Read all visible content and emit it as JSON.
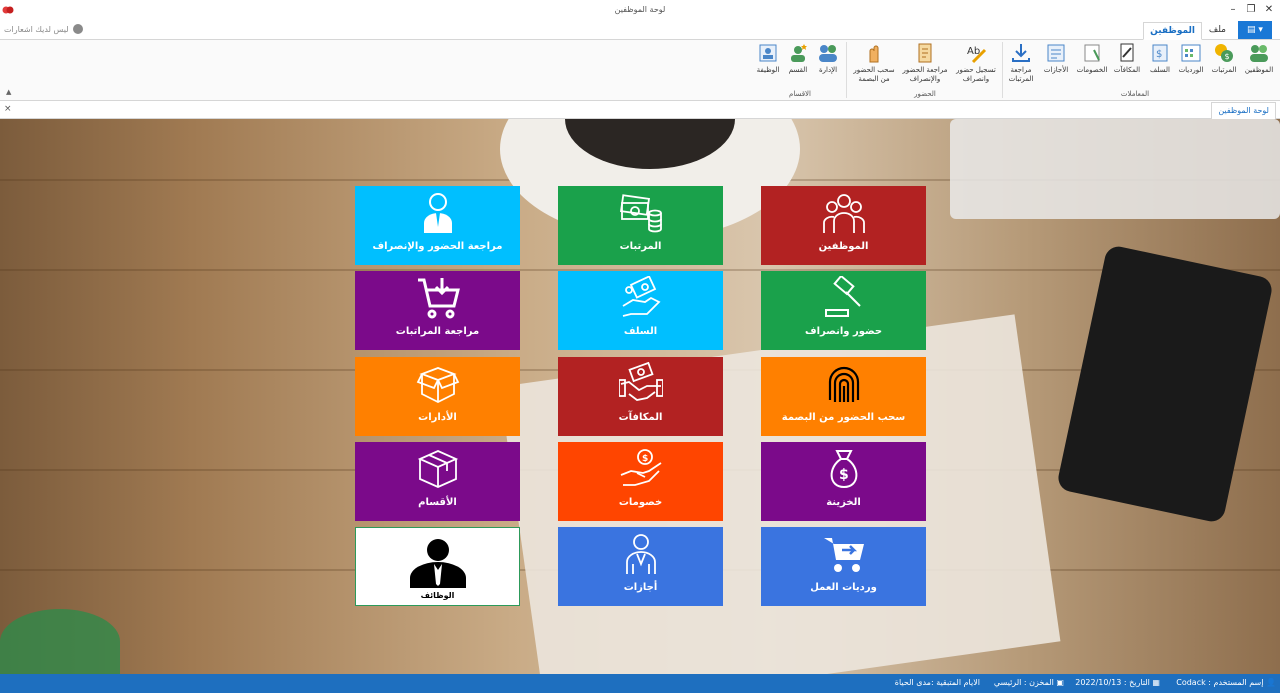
{
  "window": {
    "title": "لوحة الموظفين",
    "controls": {
      "minimize": "–",
      "restore": "❐",
      "close": "✕"
    }
  },
  "tabs": {
    "file_label": "",
    "file_icon": "app-menu-icon",
    "items": [
      {
        "label": "الموظفين",
        "active": true
      },
      {
        "label": "ملف",
        "active": false
      }
    ],
    "notifications_text": "ليس لديك اشعارات"
  },
  "ribbon": {
    "groups": {
      "transactions": "المعاملات",
      "attendance": "الحضور",
      "departments": "الاقسام"
    },
    "buttons": [
      {
        "label": "الموظفين",
        "icon": "employees-icon"
      },
      {
        "label": "المرتبات",
        "icon": "salaries-icon"
      },
      {
        "label": "الورديات",
        "icon": "shifts-icon"
      },
      {
        "label": "السلف",
        "icon": "advances-icon"
      },
      {
        "label": "المكافآت",
        "icon": "bonuses-icon"
      },
      {
        "label": "الخصومات",
        "icon": "deductions-icon"
      },
      {
        "label": "الأجازات",
        "icon": "vacations-icon"
      },
      {
        "label": "مراجعة المرتبات",
        "icon": "review-salaries-icon"
      },
      {
        "label": "تسجيل حضور وانصراف",
        "icon": "register-attendance-icon"
      },
      {
        "label": "مراجعة الحضور والإنصراف",
        "icon": "review-attendance-icon"
      },
      {
        "label": "سحب الحضور من البصمة",
        "icon": "fingerprint-pull-icon"
      },
      {
        "label": "الإدارة",
        "icon": "administration-icon"
      },
      {
        "label": "القسم",
        "icon": "section-icon"
      },
      {
        "label": "الوظيفة",
        "icon": "job-icon"
      }
    ]
  },
  "doc_tab": {
    "label": "لوحة الموظفين",
    "close": "×"
  },
  "tiles": [
    {
      "label": "مراجعة الحضور والإنصراف",
      "icon": "employee-person-icon",
      "color": "#00bfff"
    },
    {
      "label": "المرتبات",
      "icon": "money-cash-icon",
      "color": "#1aa14b"
    },
    {
      "label": "الموظفين",
      "icon": "team-group-icon",
      "color": "#b22222"
    },
    {
      "label": "مراجعة المراتبات",
      "icon": "cart-download-icon",
      "color": "#7b0a8a"
    },
    {
      "label": "السلف",
      "icon": "loan-hand-icon",
      "color": "#00bfff"
    },
    {
      "label": "حضور وانصراف",
      "icon": "gavel-icon",
      "color": "#1aa14b"
    },
    {
      "label": "الأدارات",
      "icon": "open-box-icon",
      "color": "#ff8000"
    },
    {
      "label": "المكافآت",
      "icon": "handshake-money-icon",
      "color": "#b22222"
    },
    {
      "label": "سحب الحضور من البصمة",
      "icon": "fingerprint-icon",
      "color": "#ff8000"
    },
    {
      "label": "الأقسام",
      "icon": "closed-box-icon",
      "color": "#7b0a8a"
    },
    {
      "label": "خصومات",
      "icon": "hand-coin-icon",
      "color": "#ff4500"
    },
    {
      "label": "الخزينة",
      "icon": "money-bag-icon",
      "color": "#7b0a8a"
    },
    {
      "label": "الوظائف",
      "icon": "businessman-icon",
      "color": "#ffffff"
    },
    {
      "label": "أجازات",
      "icon": "person-outline-icon",
      "color": "#3a74e0"
    },
    {
      "label": "ورديات العمل",
      "icon": "cart-arrow-icon",
      "color": "#3a74e0"
    }
  ],
  "statusbar": {
    "user": "إسم المستخدم : Codack",
    "date": "التاريخ : 2022/10/13",
    "warehouse": "المخزن : الرئيسي",
    "remaining_days": "الايام المتبقية :مدى الحياة"
  }
}
